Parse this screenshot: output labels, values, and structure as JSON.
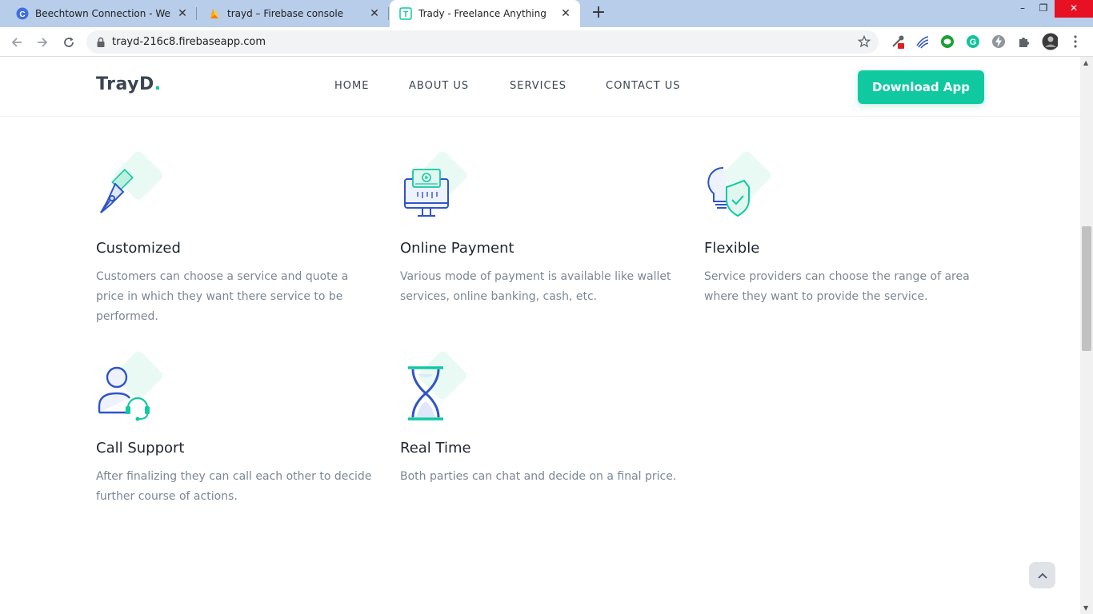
{
  "browser": {
    "tabs": [
      {
        "title": "Beechtown Connection - Website",
        "favicon": "beechtown-c-icon",
        "active": false
      },
      {
        "title": "trayd – Firebase console",
        "favicon": "firebase-icon",
        "active": false
      },
      {
        "title": "Trady - Freelance Anything",
        "favicon": "trady-t-icon",
        "active": true
      }
    ],
    "url": "trayd-216c8.firebaseapp.com"
  },
  "site": {
    "logo_text": "TrayD",
    "logo_dot": ".",
    "nav": [
      "HOME",
      "ABOUT US",
      "SERVICES",
      "CONTACT US"
    ],
    "cta_label": "Download App",
    "accent_color": "#10c9a0",
    "icon_color": "#2f54c8"
  },
  "features": [
    {
      "title": "Customized",
      "description": "Customers can choose a service and quote a price in which they want there service to be performed.",
      "icon": "pen-tool-icon"
    },
    {
      "title": "Online Payment",
      "description": "Various mode of payment is available like wallet services, online banking, cash, etc.",
      "icon": "monitor-payment-icon"
    },
    {
      "title": "Flexible",
      "description": "Service providers can choose the range of area where they want to provide the service.",
      "icon": "bulb-shield-icon"
    },
    {
      "title": "Call Support",
      "description": "After finalizing they can call each other to decide further course of actions.",
      "icon": "headset-user-icon"
    },
    {
      "title": "Real Time",
      "description": "Both parties can chat and decide on a final price.",
      "icon": "hourglass-icon"
    }
  ]
}
